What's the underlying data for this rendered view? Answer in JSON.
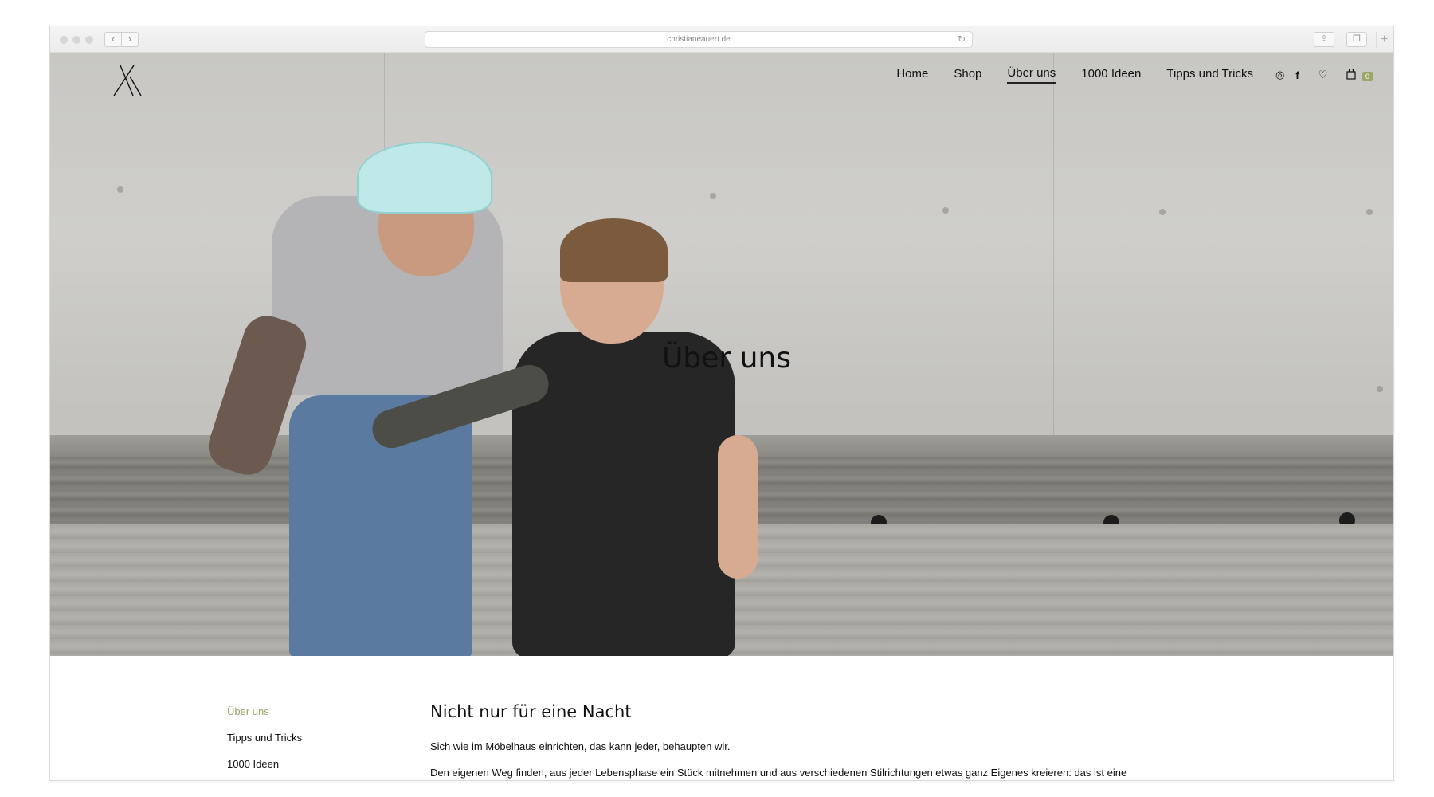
{
  "browser": {
    "url": "christianeauert.de",
    "back_label": "‹",
    "forward_label": "›",
    "reload_label": "↻",
    "share_label": "⇪",
    "tabs_label": "❐",
    "newtab_label": "+"
  },
  "site": {
    "nav": [
      {
        "label": "Home"
      },
      {
        "label": "Shop"
      },
      {
        "label": "Über uns"
      },
      {
        "label": "1000 Ideen"
      },
      {
        "label": "Tipps und Tricks"
      }
    ],
    "icons": {
      "instagram": "◎",
      "facebook": "f",
      "wishlist": "♡",
      "cart": "🛍"
    },
    "cart_count": "0",
    "hero_title": "Über uns"
  },
  "subnav": [
    {
      "label": "Über uns"
    },
    {
      "label": "Tipps und Tricks"
    },
    {
      "label": "1000 Ideen"
    }
  ],
  "article": {
    "heading": "Nicht nur für eine Nacht",
    "paragraph1": "Sich wie im Möbelhaus einrichten, das kann jeder, behaupten wir.",
    "paragraph2": "Den eigenen Weg finden, aus jeder Lebensphase ein Stück mitnehmen und aus verschiedenen Stilrichtungen etwas ganz Eigenes kreieren: das ist eine"
  },
  "colors": {
    "accent": "#9aa66a",
    "text": "#111111"
  }
}
